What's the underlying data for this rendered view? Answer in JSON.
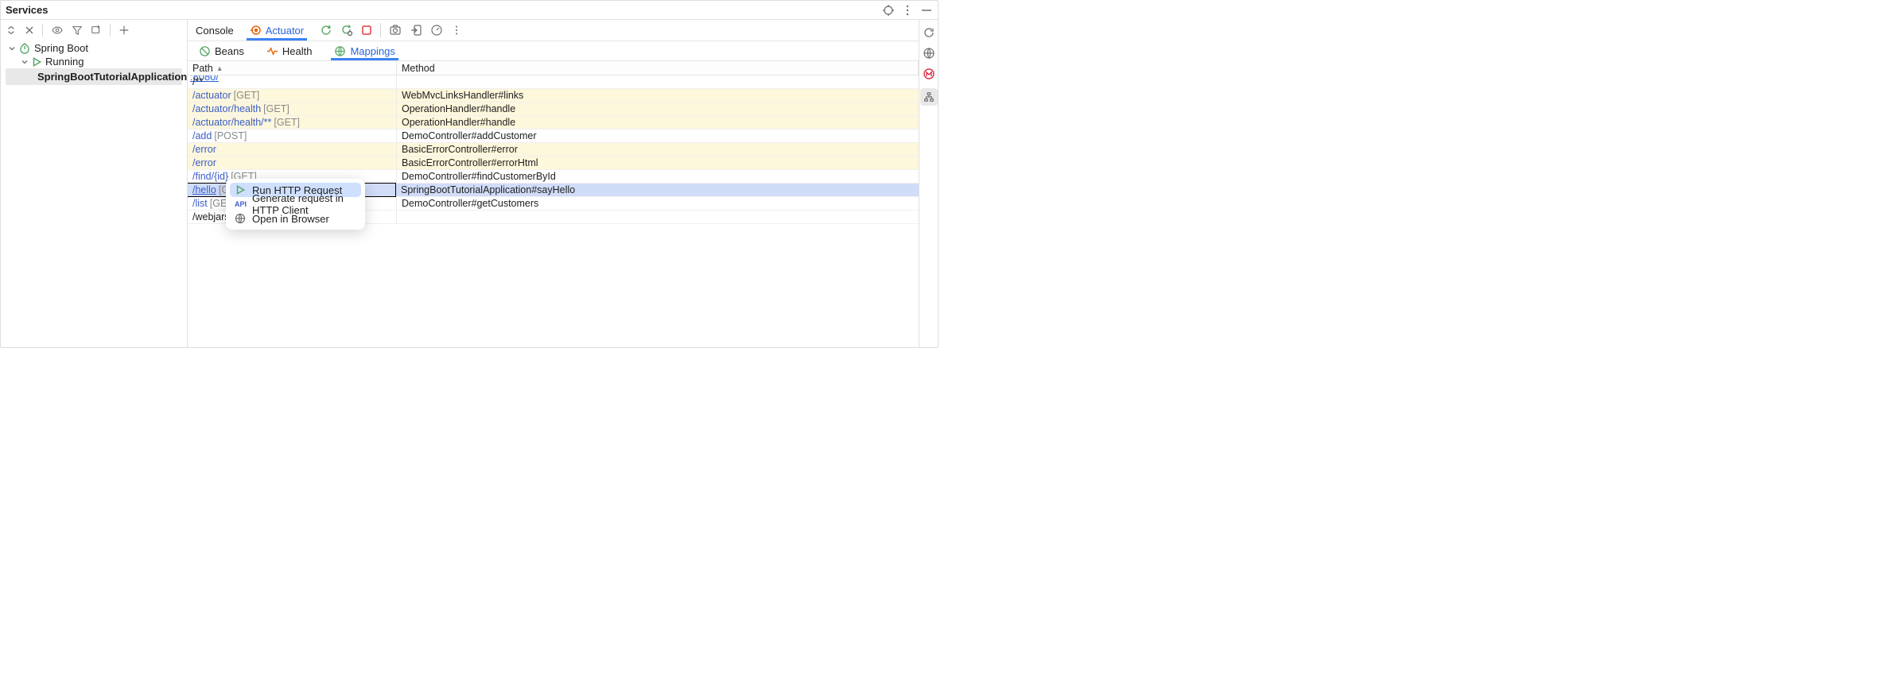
{
  "panel_title": "Services",
  "tree": {
    "root_label": "Spring Boot",
    "group_label": "Running",
    "app_label": "SpringBootTutorialApplication",
    "app_port": ":8080/"
  },
  "tabs1": {
    "console": "Console",
    "actuator": "Actuator"
  },
  "tabs2": {
    "beans": "Beans",
    "health": "Health",
    "mappings": "Mappings"
  },
  "table": {
    "col_path": "Path",
    "col_method": "Method",
    "rows": [
      {
        "path": "/**",
        "verb": "",
        "method": "",
        "hi": false,
        "link": false
      },
      {
        "path": "/actuator",
        "verb": "[GET]",
        "method": "WebMvcLinksHandler#links",
        "hi": true,
        "link": true
      },
      {
        "path": "/actuator/health",
        "verb": "[GET]",
        "method": "OperationHandler#handle",
        "hi": true,
        "link": true
      },
      {
        "path": "/actuator/health/**",
        "verb": "[GET]",
        "method": "OperationHandler#handle",
        "hi": true,
        "link": true
      },
      {
        "path": "/add",
        "verb": "[POST]",
        "method": "DemoController#addCustomer",
        "hi": false,
        "link": true
      },
      {
        "path": "/error",
        "verb": "",
        "method": "BasicErrorController#error",
        "hi": true,
        "link": true
      },
      {
        "path": "/error",
        "verb": "",
        "method": "BasicErrorController#errorHtml",
        "hi": true,
        "link": true
      },
      {
        "path": "/find/{id}",
        "verb": "[GET]",
        "method": "DemoController#findCustomerById",
        "hi": false,
        "link": true
      },
      {
        "path": "/hello",
        "verb": "[GET]",
        "method": "SpringBootTutorialApplication#sayHello",
        "hi": false,
        "link": true,
        "sel": true,
        "underline": true
      },
      {
        "path": "/list",
        "verb": "[GET]",
        "method": "DemoController#getCustomers",
        "hi": false,
        "link": true
      },
      {
        "path": "/webjars/**",
        "verb": "",
        "method": "",
        "hi": false,
        "link": false
      }
    ]
  },
  "ctx": {
    "run": "Run HTTP Request",
    "gen": "Generate request in HTTP Client",
    "open": "Open in Browser"
  }
}
